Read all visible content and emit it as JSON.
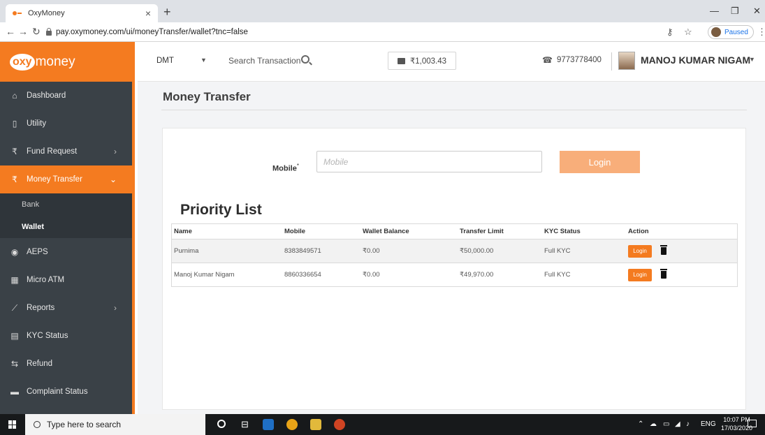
{
  "browser": {
    "tab_title": "OxyMoney",
    "url": "pay.oxymoney.com/ui/moneyTransfer/wallet?tnc=false",
    "profile_status": "Paused"
  },
  "brand": {
    "logo_oxy": "oxy",
    "logo_money": "money",
    "accent_color": "#f47b20"
  },
  "sidebar": {
    "items": [
      {
        "label": "Dashboard",
        "icon": "home-icon"
      },
      {
        "label": "Utility",
        "icon": "mobile-icon"
      },
      {
        "label": "Fund Request",
        "icon": "rupee-icon",
        "has_children": true
      },
      {
        "label": "Money Transfer",
        "icon": "rupee-icon",
        "has_children": true,
        "active": true
      },
      {
        "label": "AEPS",
        "icon": "fingerprint-icon"
      },
      {
        "label": "Micro ATM",
        "icon": "atm-icon"
      },
      {
        "label": "Reports",
        "icon": "chart-icon",
        "has_children": true
      },
      {
        "label": "KYC Status",
        "icon": "id-card-icon"
      },
      {
        "label": "Refund",
        "icon": "refund-icon"
      },
      {
        "label": "Complaint Status",
        "icon": "comment-icon"
      }
    ],
    "submenu": [
      {
        "label": "Bank"
      },
      {
        "label": "Wallet",
        "selected": true
      }
    ]
  },
  "header": {
    "service": "DMT",
    "search_label": "Search Transaction",
    "wallet_balance": "₹1,003.43",
    "phone": "9773778400",
    "user_name": "MANOJ KUMAR NIGAM"
  },
  "main": {
    "page_title": "Money Transfer",
    "mobile_label": "Mobile",
    "mobile_required": "*",
    "mobile_placeholder": "Mobile",
    "login_button": "Login",
    "priority_title": "Priority List",
    "table": {
      "columns": [
        "Name",
        "Mobile",
        "Wallet Balance",
        "Transfer Limit",
        "KYC Status",
        "Action"
      ],
      "rows": [
        {
          "name": "Purnima",
          "mobile": "8383849571",
          "wallet_balance": "₹0.00",
          "transfer_limit": "₹50,000.00",
          "kyc_status": "Full KYC",
          "action_label": "Login"
        },
        {
          "name": "Manoj Kumar Nigam",
          "mobile": "8860336654",
          "wallet_balance": "₹0.00",
          "transfer_limit": "₹49,970.00",
          "kyc_status": "Full KYC",
          "action_label": "Login"
        }
      ]
    }
  },
  "taskbar": {
    "search_placeholder": "Type here to search",
    "language": "ENG",
    "time": "10:07 PM",
    "date": "17/03/2020"
  }
}
